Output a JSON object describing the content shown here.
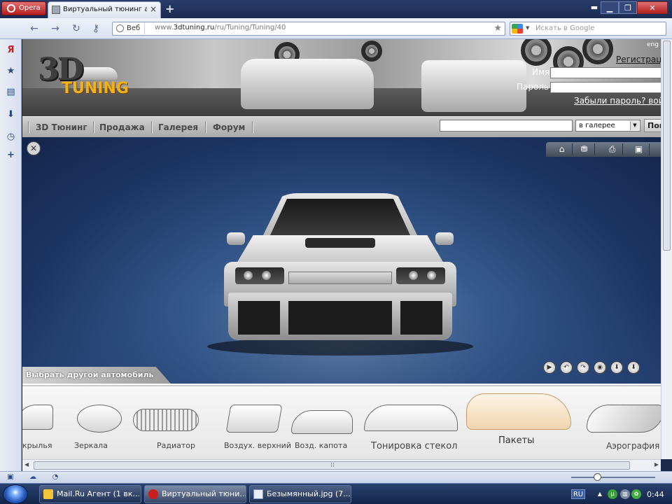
{
  "browser": {
    "menu_label": "Opera",
    "tab_title": "Виртуальный тюнинг а...",
    "new_tab": "+",
    "address": {
      "chip": "Веб",
      "url_prefix": "www.",
      "url_domain": "3dtuning.ru",
      "url_path": "/ru/Tuning/Tuning/40"
    },
    "search_placeholder": "Искать в Google"
  },
  "site": {
    "logo_3d": "3D",
    "logo_tuning": "TUNING",
    "lang": "eng",
    "register": "Регистрац",
    "name_label": "Имя",
    "password_label": "Пароль",
    "forgot": "Забыли пароль? вой",
    "nav": [
      "3D Тюнинг",
      "Продажа",
      "Галерея",
      "Форум"
    ],
    "search_scope": "в галерее",
    "search_button": "Пои",
    "pick_car": "Выбрать другой автомобиль",
    "parts": [
      {
        "label": "крылья"
      },
      {
        "label": "Зеркала"
      },
      {
        "label": "Радиатор"
      },
      {
        "label": "Воздух. верхний"
      },
      {
        "label": "Возд. капота"
      },
      {
        "label": "Тонировка стекол"
      },
      {
        "label": "Пакеты",
        "active": true
      },
      {
        "label": "Аэрография"
      }
    ]
  },
  "taskbar": {
    "tasks": [
      {
        "label": "Mail.Ru Агент (1 вк..."
      },
      {
        "label": "Виртуальный тюни...",
        "active": true
      },
      {
        "label": "Безымянный.jpg (7..."
      }
    ],
    "lang": "RU",
    "clock": "0:44"
  },
  "icons": {
    "side_panel": [
      "yandex-icon",
      "bookmarks-star-icon",
      "notes-icon",
      "downloads-icon",
      "history-clock-icon",
      "add-panel-icon"
    ],
    "top_toolbar": [
      "home-icon",
      "garage-icon",
      "print-icon",
      "card-icon"
    ],
    "controls": [
      "play-icon",
      "rotate-left-icon",
      "rotate-right-icon",
      "screenshot-icon",
      "download-icon",
      "save-icon"
    ]
  },
  "colors": {
    "logo_accent": "#f4b117",
    "stage_blue": "#1d3565"
  }
}
